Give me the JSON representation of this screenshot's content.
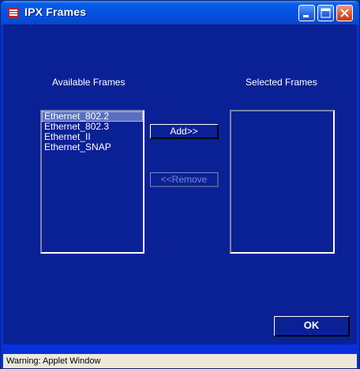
{
  "window": {
    "title": "IPX Frames",
    "icon": "app-icon",
    "controls": [
      "minimize-icon",
      "maximize-icon",
      "close-icon"
    ],
    "colors": {
      "background": "#0a2196",
      "titlebar": "#0653e4"
    }
  },
  "available": {
    "label": "Available Frames",
    "items": [
      "Ethernet_802.2",
      "Ethernet_802.3",
      "Ethernet_II",
      "Ethernet_SNAP"
    ],
    "selected_index": 0
  },
  "selected": {
    "label": "Selected Frames",
    "items": []
  },
  "buttons": {
    "add": "Add>>",
    "remove": "<<Remove",
    "ok": "OK"
  },
  "status": {
    "text": "Warning: Applet Window"
  }
}
